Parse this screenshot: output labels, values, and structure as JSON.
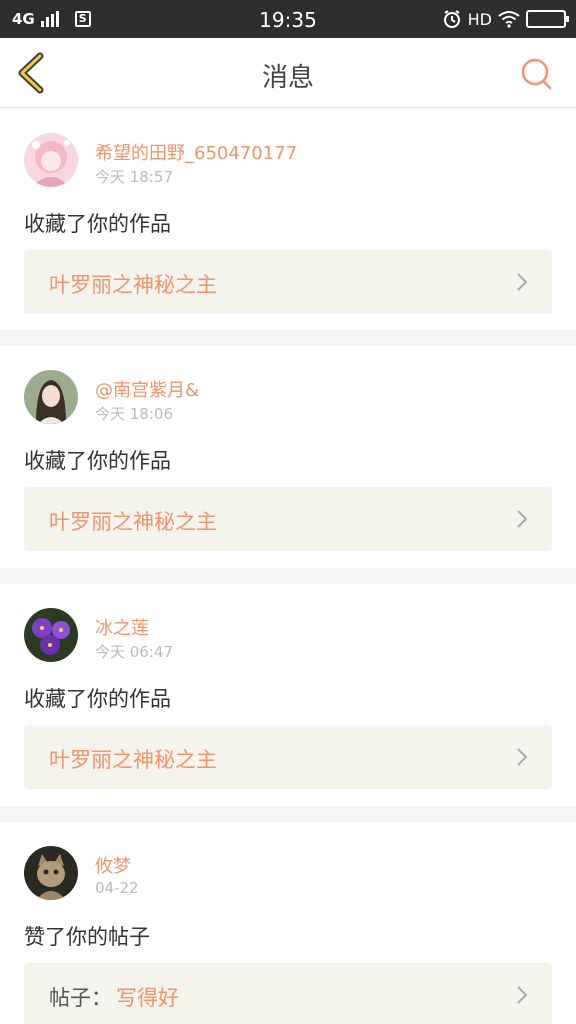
{
  "status_bar": {
    "network": "4G",
    "time": "19:35",
    "hd": "HD"
  },
  "header": {
    "title": "消息"
  },
  "colors": {
    "accent": "#f0956a",
    "box_bg": "#f4f3ec",
    "back_icon": "#f3c83a"
  },
  "messages": [
    {
      "username": "希望的田野_650470177",
      "time": "今天 18:57",
      "action": "收藏了你的作品",
      "work": "叶罗丽之神秘之主",
      "avatar": "avatar-pink-anime"
    },
    {
      "username": "@南宫紫月&",
      "time": "今天 18:06",
      "action": "收藏了你的作品",
      "work": "叶罗丽之神秘之主",
      "avatar": "avatar-girl-photo"
    },
    {
      "username": "冰之莲",
      "time": "今天 06:47",
      "action": "收藏了你的作品",
      "work": "叶罗丽之神秘之主",
      "avatar": "avatar-purple-flowers"
    },
    {
      "username": "攸梦",
      "time": "04-22",
      "action": "赞了你的帖子",
      "post_prefix": "帖子：",
      "post_title": "写得好",
      "avatar": "avatar-cat"
    }
  ]
}
